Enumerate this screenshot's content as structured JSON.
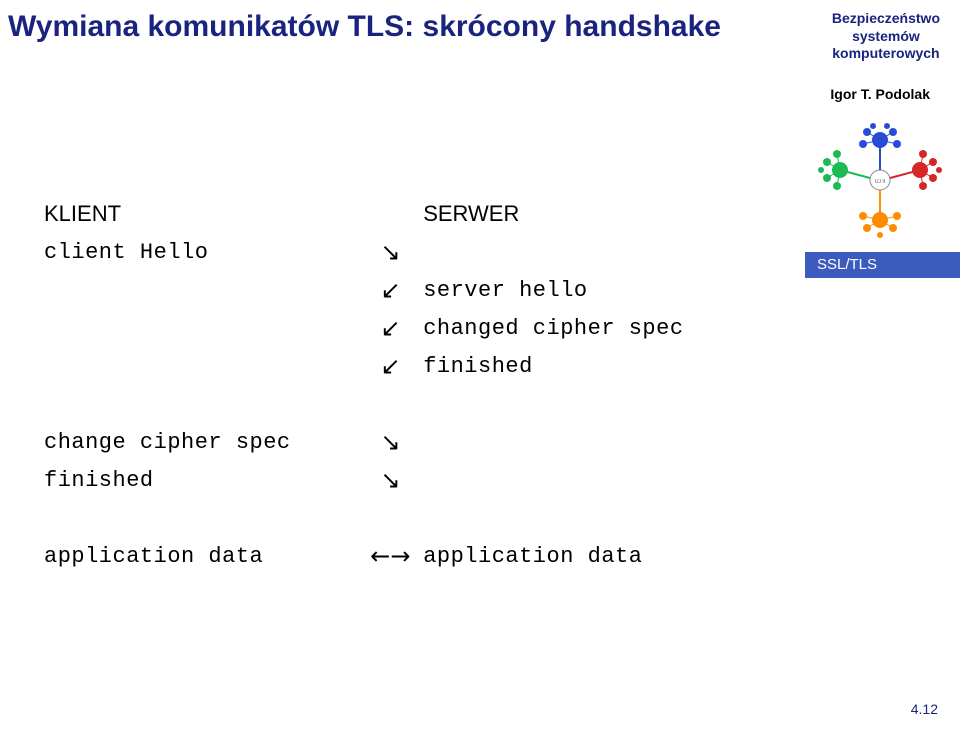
{
  "title": "Wymiana komunikatów TLS: skrócony handshake",
  "header_right": {
    "line1": "Bezpieczeństwo",
    "line2": "systemów",
    "line3": "komputerowych"
  },
  "author": "Igor T. Podolak",
  "sidebar_tag": "SSL/TLS",
  "columns": {
    "client_header": "KLIENT",
    "server_header": "SERWER"
  },
  "rows": {
    "client_hello": "client Hello",
    "server_hello": "server hello",
    "changed_cipher_spec": "changed cipher spec",
    "finished_s": "finished",
    "change_cipher_spec": "change cipher spec",
    "finished_c": "finished",
    "app_data_c": "application data",
    "app_data_s": "application data"
  },
  "arrows": {
    "to_server": "↘",
    "to_client": "↙",
    "both": "←→"
  },
  "page_number": "4.12",
  "logo_label": "UJ II"
}
